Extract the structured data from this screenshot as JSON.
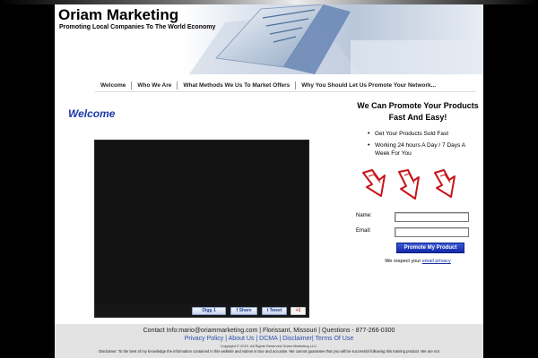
{
  "header": {
    "site_title": "Oriam Marketing",
    "tagline": "Promoting Local Companies To The World Economy"
  },
  "nav": {
    "items": [
      {
        "label": "Welcome"
      },
      {
        "label": "Who We Are"
      },
      {
        "label": "What Methods We Us To Market Offers"
      },
      {
        "label": "Why You Should Let Us Promote Your Network..."
      }
    ]
  },
  "main": {
    "heading": "Welcome",
    "share": {
      "digg": "Digg",
      "digg_count": "1",
      "facebook": "Share",
      "twitter": "Tweet",
      "gplus": "+1"
    }
  },
  "sidebar": {
    "title": "We Can Promote Your Products Fast And Easy!",
    "bullets": [
      "Get Your Products Sold Fast",
      "Working 24 hours A Day / 7 Days A Week For You"
    ],
    "form": {
      "name_label": "Name:",
      "email_label": "Email:",
      "name_value": "",
      "email_value": "",
      "submit_label": "Promote My Product",
      "respect_text": "We respect your",
      "privacy_link": "email privacy"
    }
  },
  "footer": {
    "contact": "Contact Info:mario@oriammarketing.com | Florissant, Missouri | Questions - 877-266-0300",
    "links": [
      "Privacy Policy",
      "About Us",
      "DCMA",
      "Disclaimer",
      "Terms Of Use"
    ],
    "copyright": "Copyright © 2015. All Rights Reserved Oriam Marketing LLC.",
    "disclaimer": "Disclaimer: To the best of my knowledge the information contained in this website and videos is true and accurate. We cannot guarantee that you will be successful following this training product. We are not"
  },
  "colors": {
    "accent_blue": "#1f3aa8",
    "arrow_red": "#c8141b",
    "button_blue": "#1328a8"
  }
}
